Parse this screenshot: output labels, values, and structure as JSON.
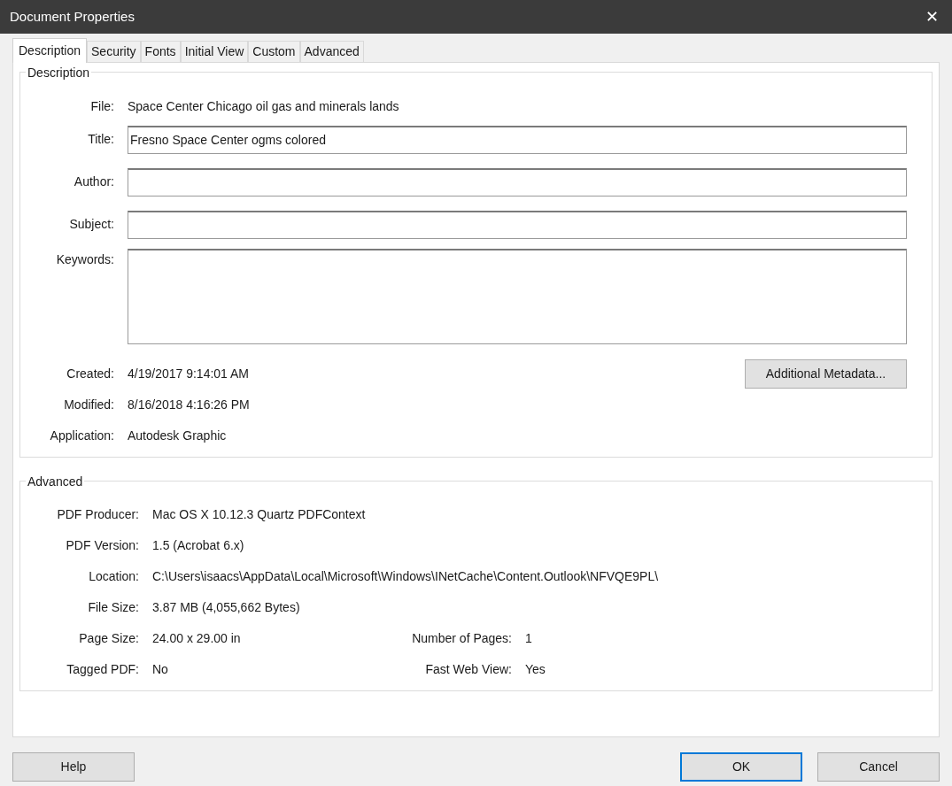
{
  "window": {
    "title": "Document Properties",
    "close": "✕"
  },
  "tabs": [
    {
      "label": "Description",
      "selected": true
    },
    {
      "label": "Security",
      "selected": false
    },
    {
      "label": "Fonts",
      "selected": false
    },
    {
      "label": "Initial View",
      "selected": false
    },
    {
      "label": "Custom",
      "selected": false
    },
    {
      "label": "Advanced",
      "selected": false
    }
  ],
  "description": {
    "legend": "Description",
    "file_label": "File:",
    "file": "Space Center Chicago oil gas and minerals lands",
    "fields": [
      {
        "label": "Title:",
        "value": "Fresno Space Center ogms colored"
      },
      {
        "label": "Author:"
      },
      {
        "label": "Subject:"
      }
    ],
    "keywords_label": "Keywords:",
    "info": [
      {
        "label": "Created:",
        "value": "4/19/2017 9:14:01 AM"
      },
      {
        "label": "Modified:",
        "value": "8/16/2018 4:16:26 PM"
      },
      {
        "label": "Application:",
        "value": "Autodesk Graphic"
      }
    ],
    "metadata_button": "Additional Metadata..."
  },
  "advanced": {
    "legend": "Advanced",
    "rows": [
      {
        "label": "PDF Producer:",
        "value": "Mac OS X 10.12.3 Quartz PDFContext"
      },
      {
        "label": "PDF Version:",
        "value": "1.5 (Acrobat 6.x)"
      },
      {
        "label": "Location:",
        "value": "C:\\Users\\isaacs\\AppData\\Local\\Microsoft\\Windows\\INetCache\\Content.Outlook\\NFVQE9PL\\"
      },
      {
        "label": "File Size:",
        "value": "3.87 MB (4,055,662 Bytes)"
      },
      {
        "label": "Page Size:",
        "value": "24.00 x 29.00 in",
        "label2": "Number of Pages:",
        "value2": "1"
      },
      {
        "label": "Tagged PDF:",
        "value": "No",
        "label2": "Fast Web View:",
        "value2": "Yes"
      }
    ]
  },
  "buttons": {
    "help": "Help",
    "ok": "OK",
    "cancel": "Cancel"
  }
}
